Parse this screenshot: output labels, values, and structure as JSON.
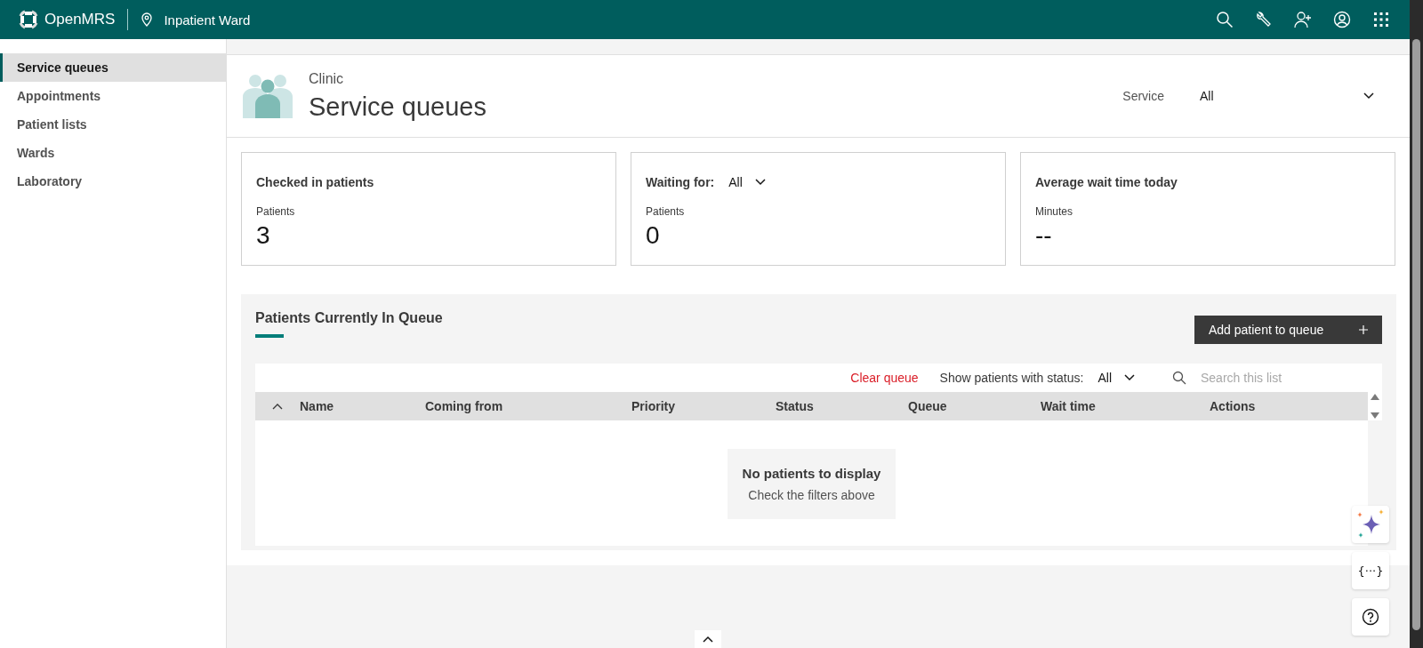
{
  "header": {
    "brand": "OpenMRS",
    "location": "Inpatient Ward"
  },
  "sidebar": {
    "items": [
      {
        "label": "Service queues",
        "selected": true
      },
      {
        "label": "Appointments",
        "selected": false
      },
      {
        "label": "Patient lists",
        "selected": false
      },
      {
        "label": "Wards",
        "selected": false
      },
      {
        "label": "Laboratory",
        "selected": false
      }
    ]
  },
  "page": {
    "breadcrumb": "Clinic",
    "title": "Service queues",
    "service_filter": {
      "label": "Service",
      "value": "All"
    }
  },
  "cards": [
    {
      "kind": "plain",
      "title": "Checked in patients",
      "label": "Patients",
      "value": "3"
    },
    {
      "kind": "dropdown",
      "title": "Waiting for:",
      "filter_value": "All",
      "label": "Patients",
      "value": "0"
    },
    {
      "kind": "plain",
      "title": "Average wait time today",
      "label": "Minutes",
      "value": "--"
    }
  ],
  "queue": {
    "title": "Patients Currently In Queue",
    "add_button": "Add patient to queue",
    "clear_button": "Clear queue",
    "status_filter": {
      "label": "Show patients with status:",
      "value": "All"
    },
    "search": {
      "placeholder": "Search this list"
    },
    "columns": [
      "Name",
      "Coming from",
      "Priority",
      "Status",
      "Queue",
      "Wait time",
      "Actions"
    ],
    "empty": {
      "title": "No patients to display",
      "hint": "Check the filters above"
    }
  },
  "code_button": "{···}"
}
